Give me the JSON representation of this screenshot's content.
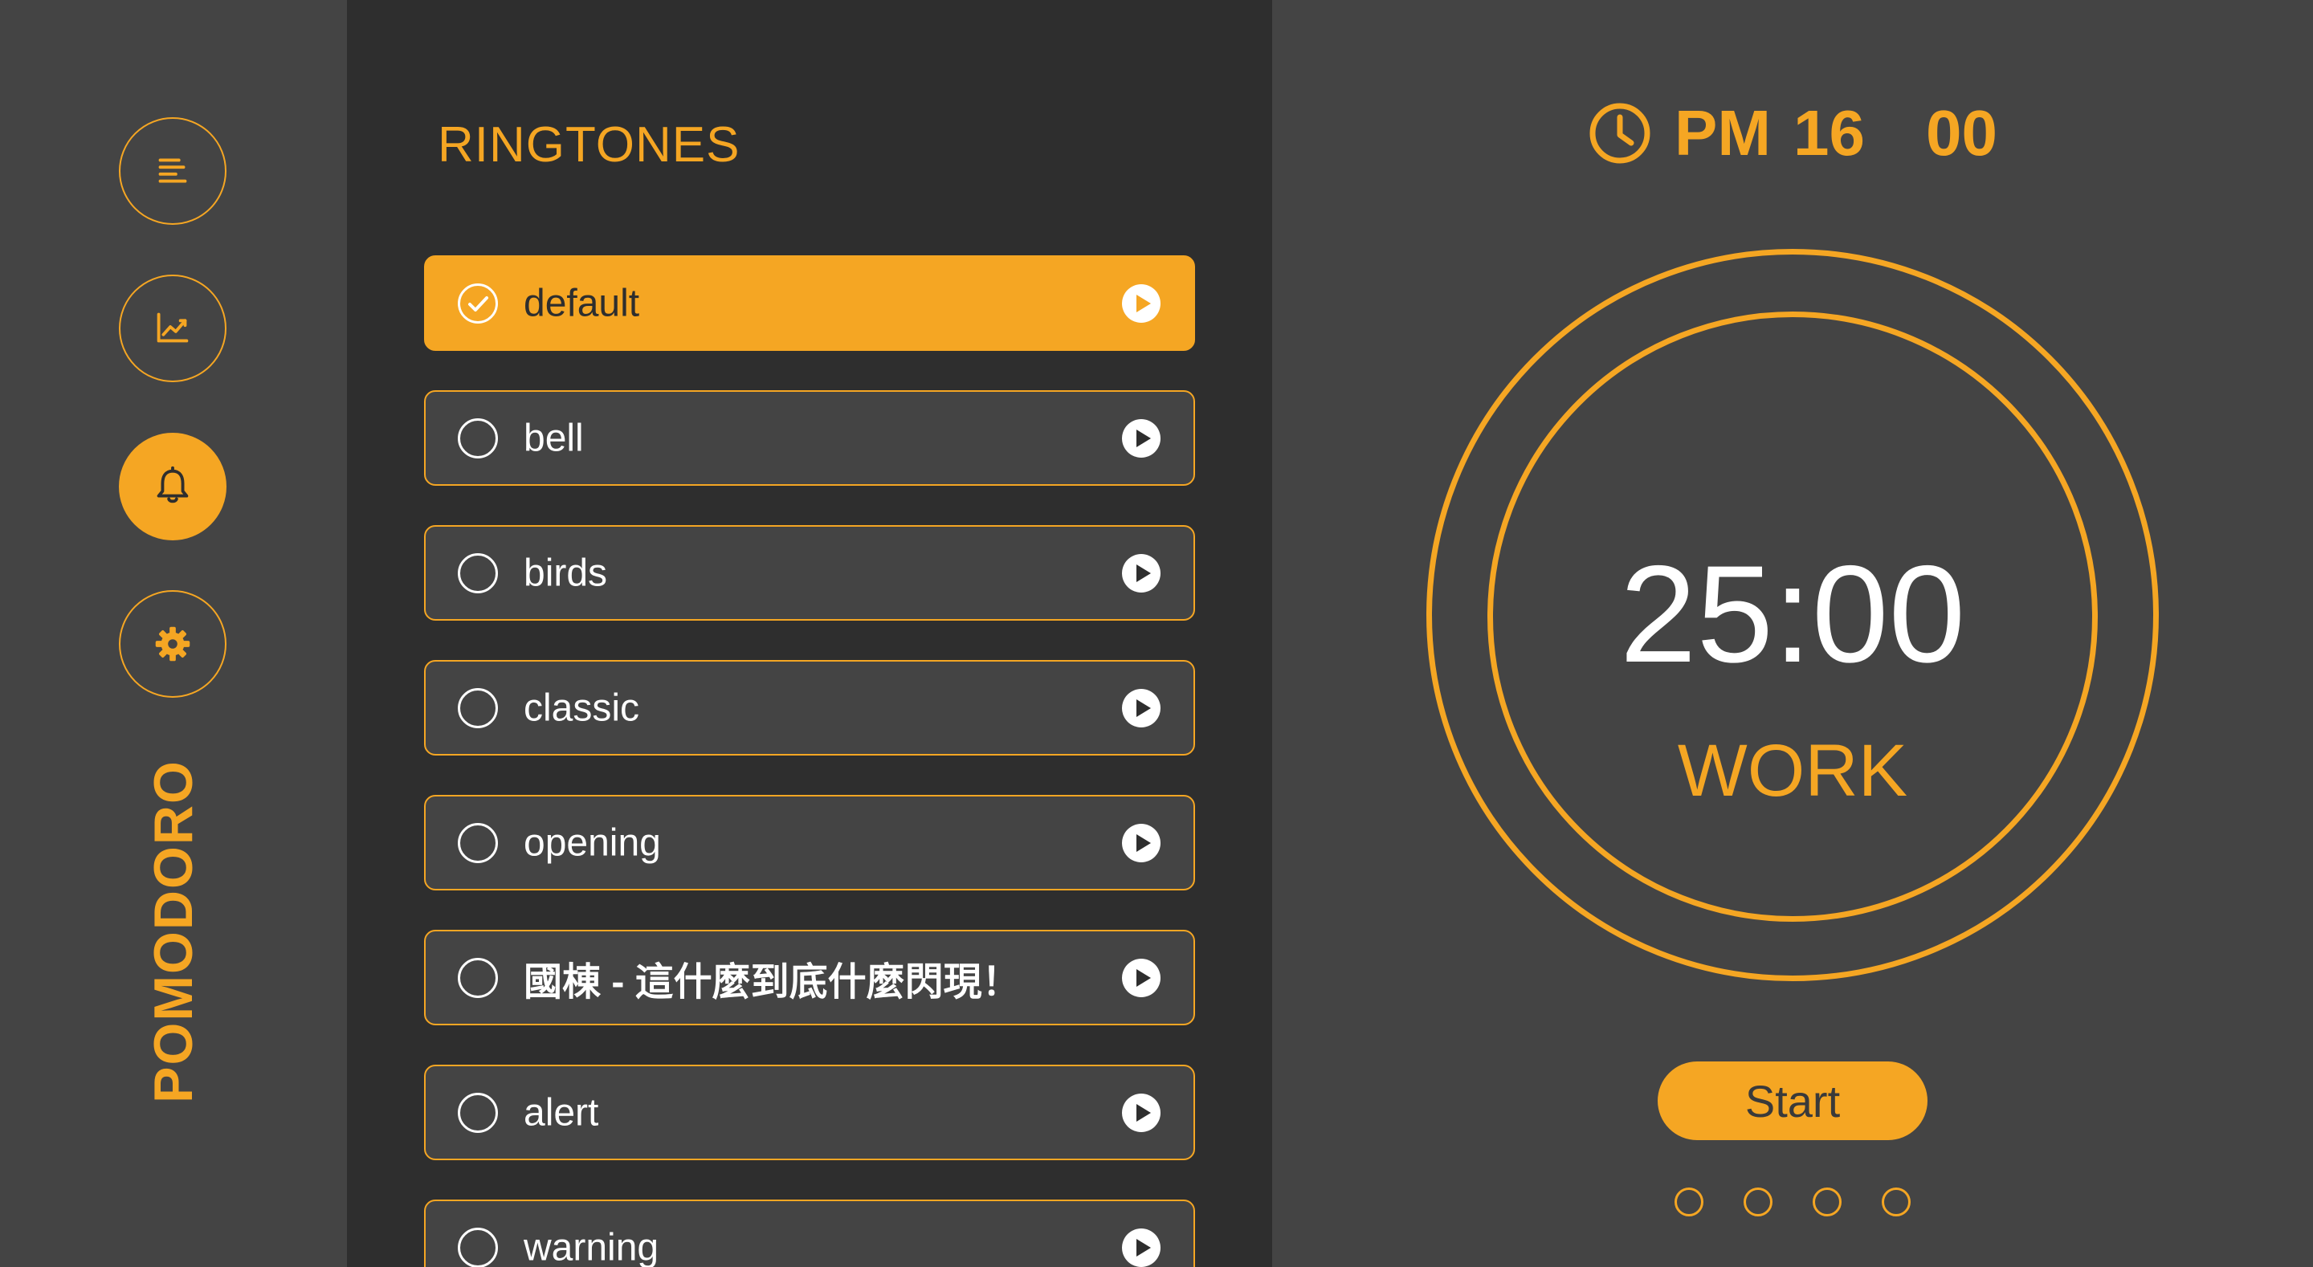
{
  "app": {
    "brand": "POMODORO"
  },
  "colors": {
    "accent": "#F5A623",
    "panel": "#2E2E2E",
    "background": "#444444",
    "text": "#FFFFFF"
  },
  "sidebar": {
    "items": [
      {
        "icon": "list-icon",
        "active": false
      },
      {
        "icon": "chart-icon",
        "active": false
      },
      {
        "icon": "bell-icon",
        "active": true
      },
      {
        "icon": "gear-icon",
        "active": false
      }
    ]
  },
  "ringtones": {
    "title": "RINGTONES",
    "items": [
      {
        "label": "default",
        "selected": true
      },
      {
        "label": "bell",
        "selected": false
      },
      {
        "label": "birds",
        "selected": false
      },
      {
        "label": "classic",
        "selected": false
      },
      {
        "label": "opening",
        "selected": false
      },
      {
        "label": "國棟 - 這什麼到底什麼閃現！",
        "selected": false
      },
      {
        "label": "alert",
        "selected": false
      },
      {
        "label": "warning",
        "selected": false
      }
    ]
  },
  "timer": {
    "clock_period": "PM",
    "clock_hour": "16",
    "clock_minute": "00",
    "time": "25:00",
    "mode": "WORK",
    "start_label": "Start",
    "progress_dots": [
      false,
      false,
      false,
      false
    ]
  }
}
